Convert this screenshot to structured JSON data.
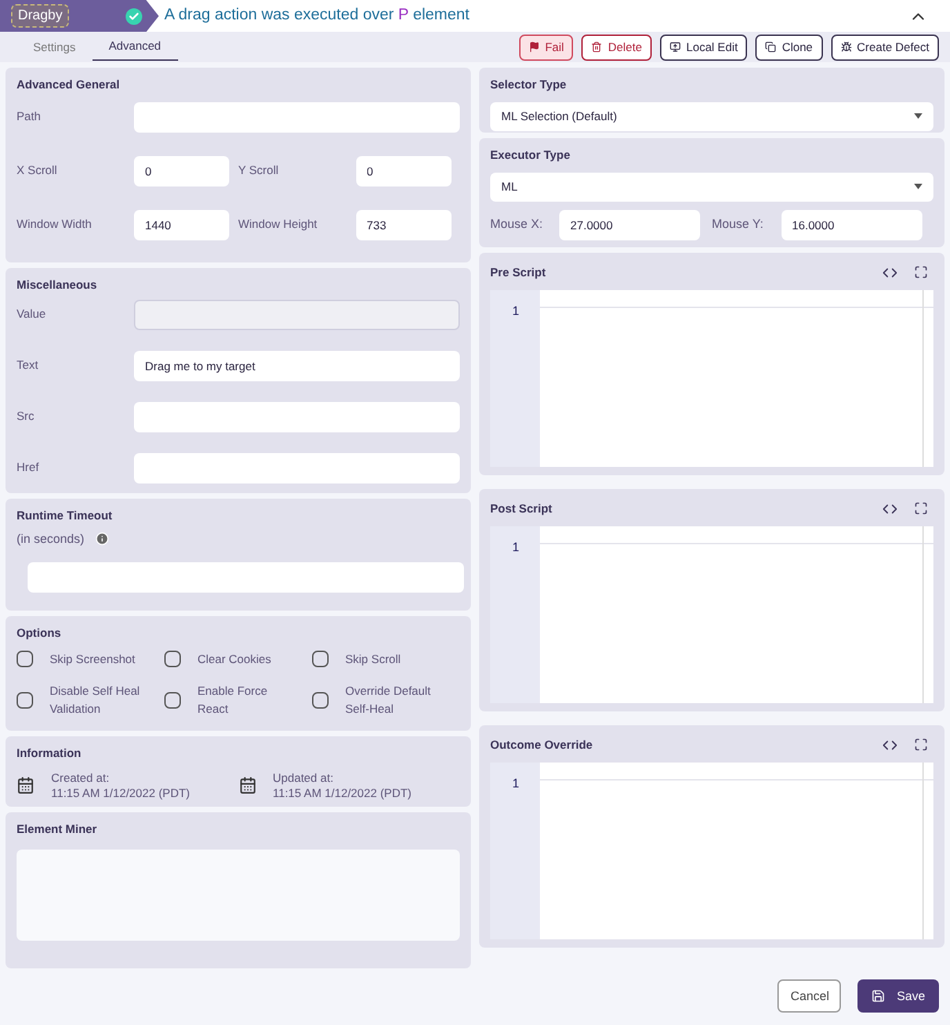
{
  "header": {
    "tag": "Dragby",
    "done": true,
    "title_prefix": "A drag action was executed over ",
    "highlight": "P",
    "title_suffix": " element",
    "expanded": true
  },
  "tabs": [
    {
      "label": "Settings",
      "selected": false
    },
    {
      "label": "Advanced",
      "selected": true
    }
  ],
  "actions": [
    {
      "kind": "fail",
      "label": "Fail"
    },
    {
      "kind": "delete",
      "label": "Delete"
    },
    {
      "kind": "edit",
      "label": "Local Edit"
    },
    {
      "kind": "clone",
      "label": "Clone"
    },
    {
      "kind": "defect",
      "label": "Create Defect"
    }
  ],
  "advanced_general": {
    "title": "Advanced General",
    "path": {
      "label": "Path"
    },
    "pairs": [
      [
        {
          "label": "X Scroll",
          "value": "0"
        },
        {
          "label": "Y Scroll",
          "value": "0"
        }
      ],
      [
        {
          "label": "Window Width",
          "value": "1440"
        },
        {
          "label": "Window Height",
          "value": "733"
        }
      ]
    ]
  },
  "miscellaneous": {
    "title": "Miscellaneous",
    "fields": [
      {
        "label": "Value",
        "disabled": true
      },
      {
        "label": "Text",
        "value": "Drag me to my target",
        "disabled": false
      },
      {
        "label": "Src",
        "disabled": false
      },
      {
        "label": "Href",
        "disabled": false
      }
    ]
  },
  "runtime_timeout": {
    "title": "Runtime Timeout",
    "subtitle": "(in seconds)"
  },
  "options": {
    "title": "Options",
    "items": [
      {
        "label": "Skip Screenshot",
        "checked": false
      },
      {
        "label": "Clear Cookies",
        "checked": false
      },
      {
        "label": "Skip Scroll",
        "checked": false
      },
      {
        "label": "Disable Self Heal Validation",
        "checked": false
      },
      {
        "label": "Enable Force React",
        "checked": false
      },
      {
        "label": "Override Default Self-Heal",
        "checked": false
      }
    ]
  },
  "information": {
    "title": "Information",
    "items": [
      {
        "label": "Created at:",
        "value": "11:15 AM 1/12/2022 (PDT)"
      },
      {
        "label": "Updated at:",
        "value": "11:15 AM 1/12/2022 (PDT)"
      }
    ]
  },
  "element_miner": {
    "title": "Element Miner"
  },
  "selector_type": {
    "title": "Selector Type",
    "value": "ML Selection (Default)"
  },
  "executor_type": {
    "title": "Executor Type",
    "value": "ML",
    "mouse": [
      {
        "label": "Mouse X:",
        "value": "27.0000"
      },
      {
        "label": "Mouse Y:",
        "value": "16.0000"
      }
    ]
  },
  "editors": [
    {
      "title": "Pre Script",
      "line": "1"
    },
    {
      "title": "Post Script",
      "line": "1"
    },
    {
      "title": "Outcome Override",
      "line": "1"
    }
  ],
  "footer": {
    "cancel": "Cancel",
    "save": "Save"
  }
}
